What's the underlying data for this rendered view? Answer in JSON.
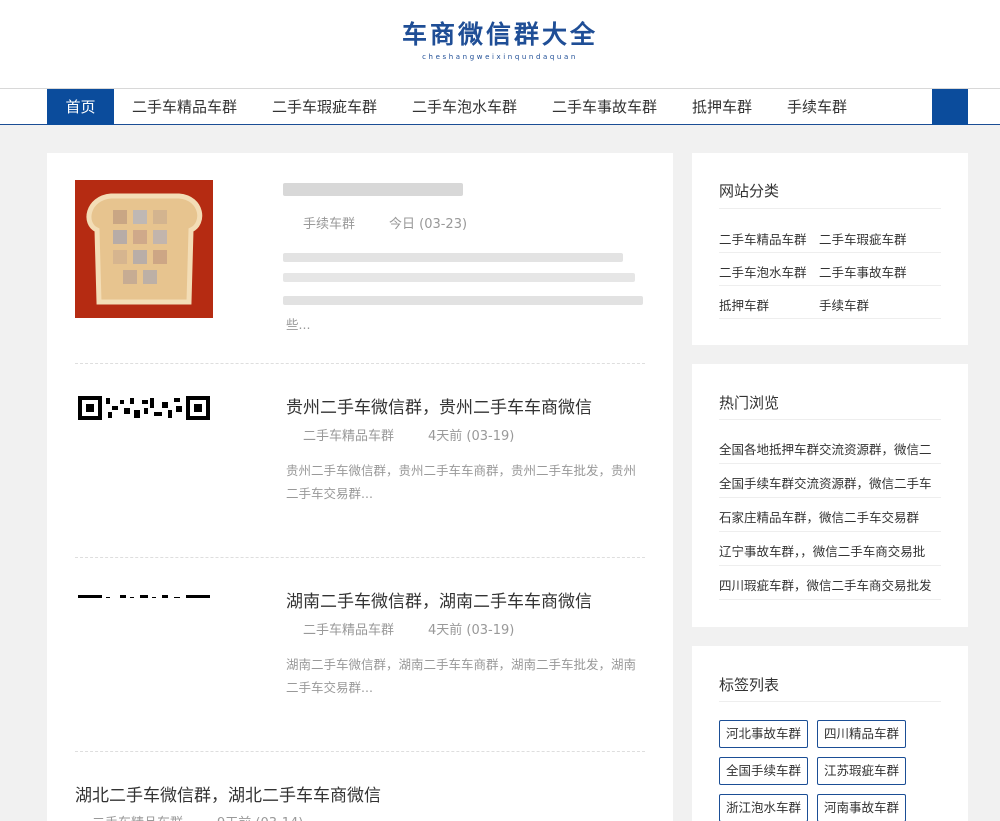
{
  "header": {
    "site_title": "车商微信群大全",
    "site_subtitle": "cheshangweixinqundaquan"
  },
  "nav": {
    "home": "首页",
    "items": [
      "二手车精品车群",
      "二手车瑕疵车群",
      "二手车泡水车群",
      "二手车事故车群",
      "抵押车群",
      "手续车群"
    ]
  },
  "posts": [
    {
      "title": "",
      "category": "手续车群",
      "date": "今日 (03-23)",
      "excerpt": "些..."
    },
    {
      "title": "贵州二手车微信群，贵州二手车车商微信",
      "category": "二手车精品车群",
      "date": "4天前 (03-19)",
      "excerpt": "贵州二手车微信群，贵州二手车车商群，贵州二手车批发，贵州二手车交易群..."
    },
    {
      "title": "湖南二手车微信群，湖南二手车车商微信",
      "category": "二手车精品车群",
      "date": "4天前 (03-19)",
      "excerpt": "湖南二手车微信群，湖南二手车车商群，湖南二手车批发，湖南二手车交易群..."
    },
    {
      "title": "湖北二手车微信群，湖北二手车车商微信",
      "category": "二手车精品车群",
      "date": "9天前 (03-14)"
    }
  ],
  "sidebar": {
    "categories": {
      "title": "网站分类",
      "links": [
        "二手车精品车群",
        "二手车瑕疵车群",
        "二手车泡水车群",
        "二手车事故车群",
        "抵押车群",
        "手续车群"
      ]
    },
    "hot": {
      "title": "热门浏览",
      "links": [
        "全国各地抵押车群交流资源群，微信二",
        "全国手续车群交流资源群，微信二手车",
        "石家庄精品车群，微信二手车交易群",
        "辽宁事故车群，，微信二手车商交易批",
        "四川瑕疵车群，微信二手车商交易批发"
      ]
    },
    "tags": {
      "title": "标签列表",
      "items": [
        "河北事故车群",
        "四川精品车群",
        "全国手续车群",
        "江苏瑕疵车群",
        "浙江泡水车群",
        "河南事故车群"
      ]
    }
  }
}
